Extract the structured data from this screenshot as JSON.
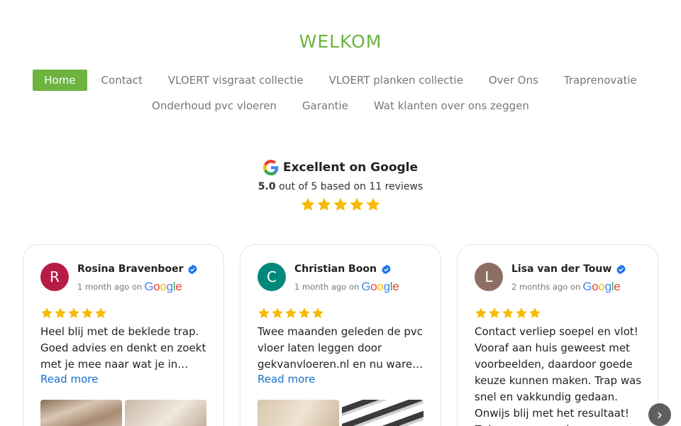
{
  "site": {
    "title": "WELKOM"
  },
  "nav": {
    "row1": [
      "Home",
      "Contact",
      "VLOERT visgraat collectie",
      "VLOERT planken collectie",
      "Over Ons",
      "Traprenovatie"
    ],
    "row2": [
      "Onderhoud pvc vloeren",
      "Garantie",
      "Wat klanten over ons zeggen"
    ],
    "active": "Home",
    "accent": "#6db33f"
  },
  "summary": {
    "title": "Excellent on Google",
    "rating": "5.0",
    "rating_text": "out of 5 based on 11 reviews",
    "stars": 5,
    "icon": "google-g-icon"
  },
  "reviews": [
    {
      "initial": "R",
      "avatar_color": "#b71c47",
      "name": "Rosina Bravenboer",
      "time": "1 month ago on",
      "stars": 5,
      "text": "Heel blij met de beklede trap. Goed advies en denkt en zoekt met je mee naar wat je in…",
      "read_more": "Read more"
    },
    {
      "initial": "C",
      "avatar_color": "#00897b",
      "name": "Christian Boon",
      "time": "1 month ago on",
      "stars": 5,
      "text": "Twee maanden geleden de pvc vloer laten leggen door gekvanvloeren.nl en nu waren d…",
      "read_more": "Read more"
    },
    {
      "initial": "L",
      "avatar_color": "#8d6e63",
      "name": "Lisa van der Touw",
      "time": "2 months ago on",
      "stars": 5,
      "text": "Contact verliep soepel en vlot! Vooraf aan huis geweest met voorbeelden, daardoor goede keuze kunnen maken. Trap was snel en vakkundig gedaan. Onwijs blij met het resultaat! Zeker een aanrader."
    }
  ],
  "google_wordmark": [
    "G",
    "o",
    "o",
    "g",
    "l",
    "e"
  ],
  "google_colors": [
    "#4285F4",
    "#EA4335",
    "#FBBC05",
    "#4285F4",
    "#34A853",
    "#EA4335"
  ],
  "star_color": "#f6bb06",
  "next_arrow": "›"
}
